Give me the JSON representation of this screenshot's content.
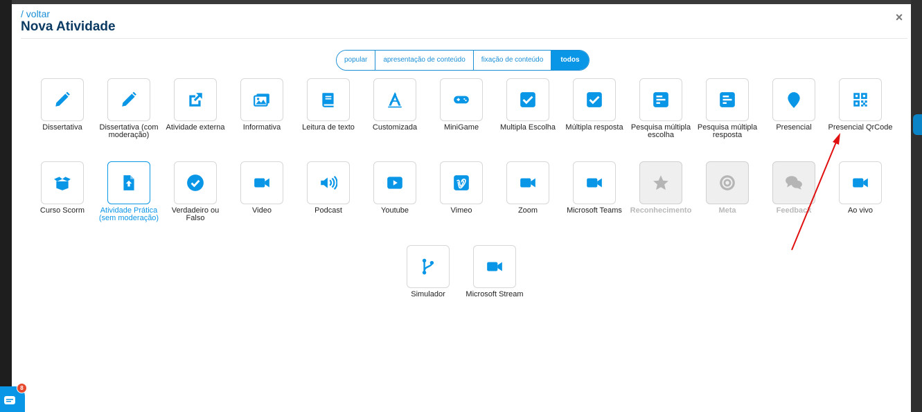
{
  "header": {
    "back_label": "/ voltar",
    "title": "Nova Atividade"
  },
  "filters": [
    {
      "label": "popular",
      "active": false
    },
    {
      "label": "apresentação de conteúdo",
      "active": false
    },
    {
      "label": "fixação de conteúdo",
      "active": false
    },
    {
      "label": "todos",
      "active": true
    }
  ],
  "activities": {
    "row1": [
      {
        "label": "Dissertativa",
        "icon": "pencil-icon"
      },
      {
        "label": "Dissertativa (com moderação)",
        "icon": "pencil-icon"
      },
      {
        "label": "Atividade externa",
        "icon": "external-link-icon"
      },
      {
        "label": "Informativa",
        "icon": "images-icon"
      },
      {
        "label": "Leitura de texto",
        "icon": "book-icon"
      },
      {
        "label": "Customizada",
        "icon": "drafting-compass-icon"
      },
      {
        "label": "MiniGame",
        "icon": "gamepad-icon"
      },
      {
        "label": "Multipla Escolha",
        "icon": "checkbox-icon"
      },
      {
        "label": "Múltipla resposta",
        "icon": "checkbox-icon"
      },
      {
        "label": "Pesquisa múltipla escolha",
        "icon": "poll-icon"
      },
      {
        "label": "Pesquisa múltipla resposta",
        "icon": "poll-icon"
      },
      {
        "label": "Presencial",
        "icon": "map-pin-icon"
      },
      {
        "label": "Presencial QrCode",
        "icon": "qrcode-icon"
      }
    ],
    "row2": [
      {
        "label": "Curso Scorm",
        "icon": "box-open-icon"
      },
      {
        "label": "Atividade Prática (sem moderação)",
        "icon": "file-upload-icon"
      },
      {
        "label": "Verdadeiro ou Falso",
        "icon": "check-circle-icon"
      },
      {
        "label": "Video",
        "icon": "video-camera-icon"
      },
      {
        "label": "Podcast",
        "icon": "volume-icon"
      },
      {
        "label": "Youtube",
        "icon": "youtube-icon"
      },
      {
        "label": "Vimeo",
        "icon": "vimeo-icon"
      },
      {
        "label": "Zoom",
        "icon": "video-camera-icon"
      },
      {
        "label": "Microsoft Teams",
        "icon": "video-camera-icon"
      },
      {
        "label": "Reconhecimento",
        "icon": "star-icon"
      },
      {
        "label": "Meta",
        "icon": "target-icon"
      },
      {
        "label": "Feedback",
        "icon": "comments-icon"
      },
      {
        "label": "Ao vivo",
        "icon": "video-camera-icon"
      }
    ],
    "row3": [
      {
        "label": "Simulador",
        "icon": "code-branch-icon"
      },
      {
        "label": "Microsoft Stream",
        "icon": "video-camera-icon"
      }
    ]
  },
  "chat": {
    "badge_count": "8"
  },
  "colors": {
    "accent": "#0a96e6",
    "title": "#0b3a63",
    "disabled": "#b9b9b9",
    "annotation_arrow": "#e01010"
  }
}
